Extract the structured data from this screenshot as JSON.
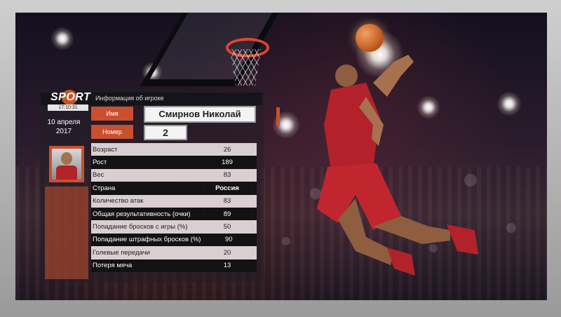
{
  "overlay": {
    "logo_text": "SPORT",
    "time": "17:10:31",
    "header_title": "Информация об игроке",
    "date_line1": "10 апреля",
    "date_line2": "2017",
    "name_label": "Имя",
    "name_value": "Смирнов Николай",
    "number_label": "Номер",
    "number_value": "2",
    "stats": [
      {
        "label": "Возраст",
        "value": "26"
      },
      {
        "label": "Рост",
        "value": "189"
      },
      {
        "label": "Вес",
        "value": "83"
      },
      {
        "label": "Страна",
        "value": "Россия"
      },
      {
        "label": "Количество атак",
        "value": "83"
      },
      {
        "label": "Общая результативность (очки)",
        "value": "89"
      },
      {
        "label": "Попадание бросков с игры (%)",
        "value": "50"
      },
      {
        "label": "Попадание штрафных бросков (%)",
        "value": "90"
      },
      {
        "label": "Голевые передачи",
        "value": "20"
      },
      {
        "label": "Потеря мяча",
        "value": "13"
      }
    ]
  },
  "colors": {
    "accent": "#c9502e",
    "row_light": "#e8dede",
    "row_dark": "#121014",
    "jersey": "#b3222a"
  },
  "icons": [
    "basketball-icon",
    "player-photo"
  ]
}
